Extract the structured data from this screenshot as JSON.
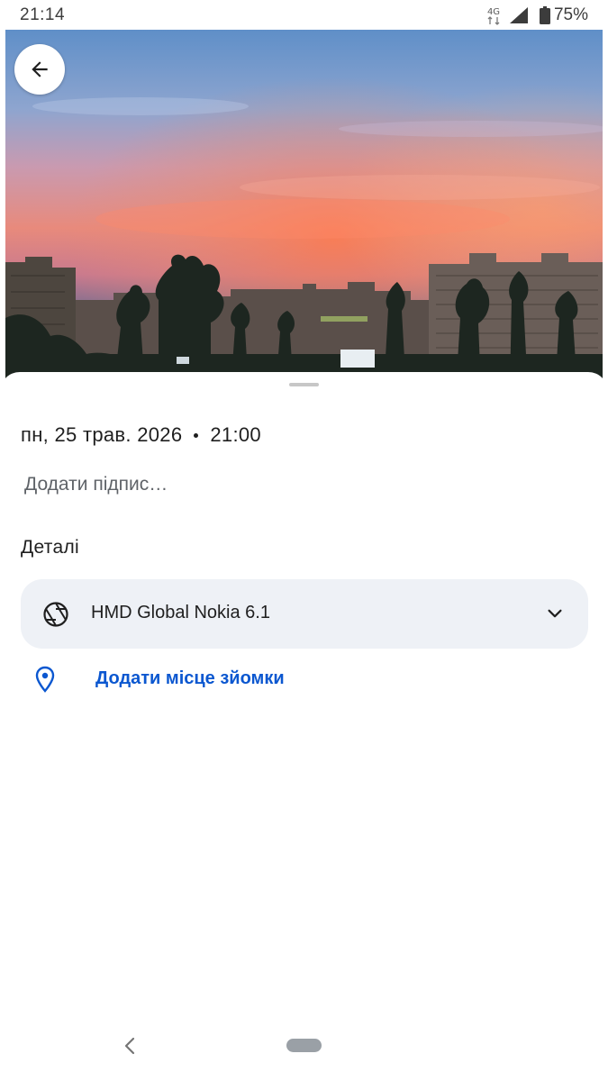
{
  "status_bar": {
    "time": "21:14",
    "network": "4G",
    "battery": "75%"
  },
  "photo": {
    "subject": "sunset over apartment buildings"
  },
  "sheet": {
    "date": "пн, 25 трав. 2026",
    "time": "21:00",
    "caption_placeholder": "Додати підпис…",
    "details_title": "Деталі",
    "camera": "HMD Global Nokia 6.1",
    "add_location": "Додати місце зйомки"
  },
  "colors": {
    "accent": "#0b57d0",
    "card": "#eef1f6"
  },
  "icons": [
    "back-arrow-icon",
    "camera-aperture-icon",
    "chevron-down-icon",
    "location-pin-icon",
    "nav-back-icon"
  ]
}
